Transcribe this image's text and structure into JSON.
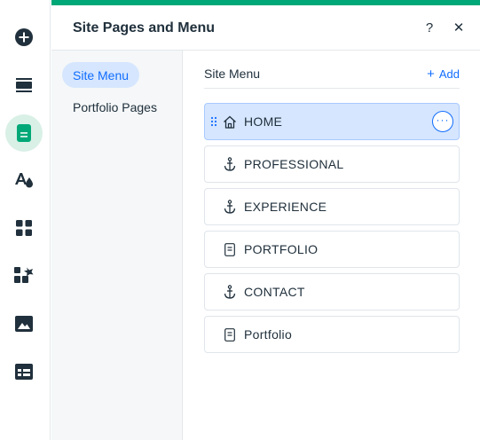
{
  "rail": {
    "items": [
      {
        "name": "add-elements",
        "icon": "plus-circle-icon"
      },
      {
        "name": "sections",
        "icon": "sections-icon"
      },
      {
        "name": "pages-menu",
        "icon": "page-icon",
        "active": true
      },
      {
        "name": "site-design",
        "icon": "theme-icon"
      },
      {
        "name": "apps",
        "icon": "apps-grid-icon"
      },
      {
        "name": "business-tools",
        "icon": "puzzle-icon"
      },
      {
        "name": "media",
        "icon": "image-icon"
      },
      {
        "name": "cms",
        "icon": "table-icon"
      }
    ]
  },
  "panel": {
    "title": "Site Pages and Menu",
    "help_label": "?",
    "close_label": "✕"
  },
  "subnav": {
    "items": [
      {
        "label": "Site Menu",
        "active": true
      },
      {
        "label": "Portfolio Pages",
        "active": false
      }
    ]
  },
  "content": {
    "title": "Site Menu",
    "add_plus": "+",
    "add_label": "Add",
    "more_label": "···",
    "pages": [
      {
        "label": "HOME",
        "icon": "home-icon",
        "selected": true
      },
      {
        "label": "PROFESSIONAL",
        "icon": "anchor-icon",
        "selected": false
      },
      {
        "label": "EXPERIENCE",
        "icon": "anchor-icon",
        "selected": false
      },
      {
        "label": "PORTFOLIO",
        "icon": "page-icon",
        "selected": false
      },
      {
        "label": "CONTACT",
        "icon": "anchor-icon",
        "selected": false
      },
      {
        "label": "Portfolio",
        "icon": "page-icon",
        "selected": false
      }
    ]
  },
  "colors": {
    "accent": "#00a877",
    "brand_blue": "#116dff",
    "selected_bg": "#d6e6fe",
    "active_rail_bg": "#d9f0e6"
  }
}
